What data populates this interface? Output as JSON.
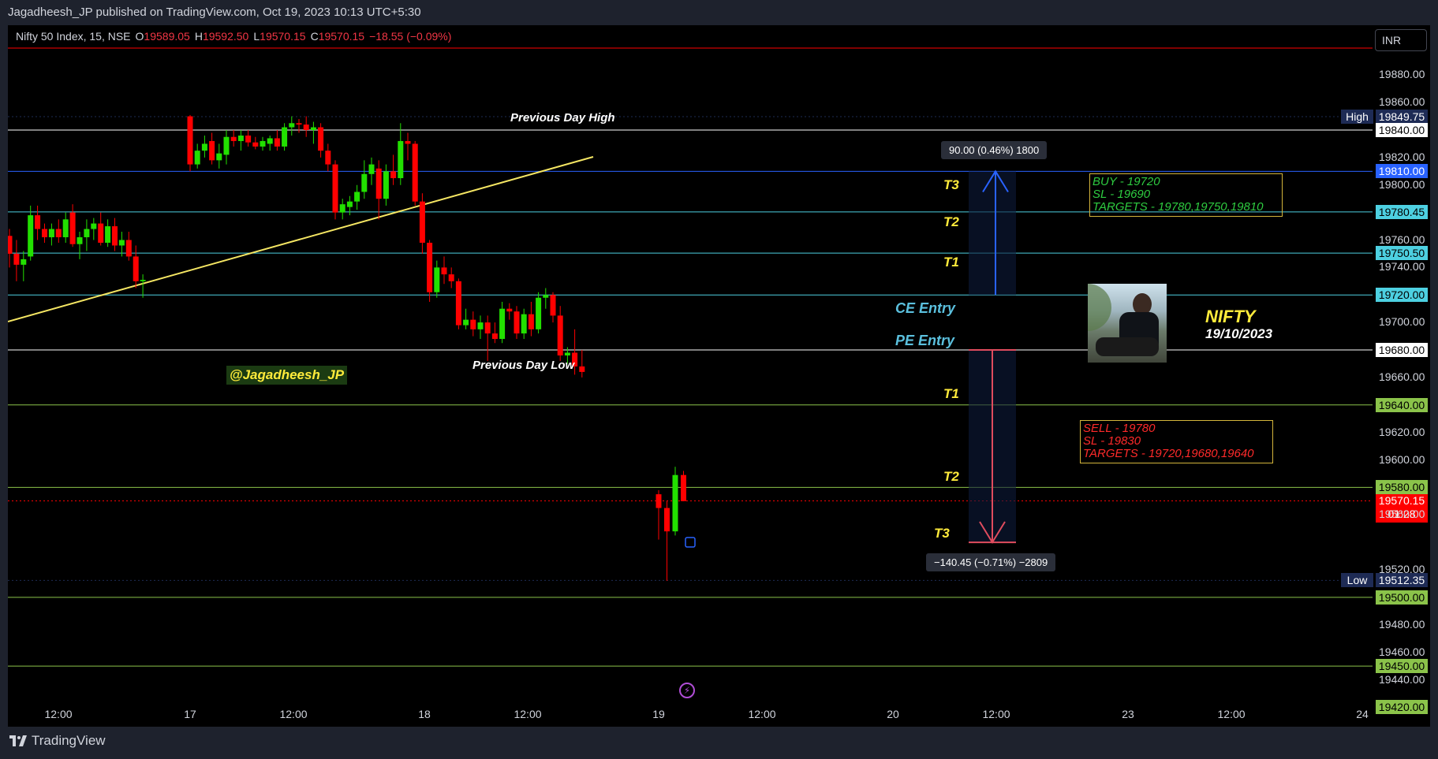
{
  "header": {
    "published_by": "Jagadheesh_JP published on TradingView.com, Oct 19, 2023 10:13 UTC+5:30"
  },
  "legend": {
    "symbol": "Nifty 50 Index, 15, NSE",
    "open_label": "O",
    "open": "19589.05",
    "high_label": "H",
    "high": "19592.50",
    "low_label": "L",
    "low": "19570.15",
    "close_label": "C",
    "close": "19570.15",
    "change": "−18.55 (−0.09%)"
  },
  "currency": "INR",
  "footer": {
    "logo_text": "TradingView"
  },
  "annotations": {
    "prev_day_high": "Previous Day High",
    "prev_day_low": "Previous Day Low",
    "handle": "@Jagadheesh_JP",
    "ce_entry": "CE Entry",
    "pe_entry": "PE Entry",
    "t3_up": "T3",
    "t2_up": "T2",
    "t1_up": "T1",
    "t1_down": "T1",
    "t2_down": "T2",
    "t3_down": "T3",
    "measure_up": "90.00 (0.46%) 1800",
    "measure_down": "−140.45 (−0.71%) −2809",
    "buy_lines": [
      "BUY - 19720",
      "SL - 19690",
      "TARGETS - 19780,19750,19810"
    ],
    "sell_lines": [
      "SELL - 19780",
      "SL - 19830",
      "TARGETS - 19720,19680,19640"
    ],
    "nifty_title": "NIFTY",
    "nifty_date": "19/10/2023"
  },
  "colors": {
    "up": "#22e000",
    "down": "#ff0000",
    "background": "#000000",
    "trendline": "#f5e663",
    "line_blue": "#2962ff",
    "line_cyan": "#4dd0e1",
    "line_green": "#8bc34a",
    "line_white": "#ffffff"
  },
  "price_labels": [
    {
      "value": "19849.75",
      "tag": "High",
      "bg": "#1e2b55",
      "fg": "#ffffff"
    },
    {
      "value": "19840.00",
      "bg": "#ffffff",
      "fg": "#000000"
    },
    {
      "value": "19810.00",
      "bg": "#2962ff",
      "fg": "#ffffff"
    },
    {
      "value": "19780.45",
      "bg": "#4dd0e1",
      "fg": "#000000"
    },
    {
      "value": "19750.50",
      "bg": "#4dd0e1",
      "fg": "#000000"
    },
    {
      "value": "19720.00",
      "bg": "#4dd0e1",
      "fg": "#000000"
    },
    {
      "value": "19680.00",
      "bg": "#ffffff",
      "fg": "#000000"
    },
    {
      "value": "19640.00",
      "bg": "#8bc34a",
      "fg": "#000000"
    },
    {
      "value": "19580.00",
      "bg": "#8bc34a",
      "fg": "#000000"
    },
    {
      "value": "19570.15",
      "sub": "01:28",
      "bg": "#ff0000",
      "fg": "#ffffff"
    },
    {
      "value": "19512.35",
      "tag": "Low",
      "bg": "#1e2b55",
      "fg": "#ffffff"
    },
    {
      "value": "19500.00",
      "bg": "#8bc34a",
      "fg": "#000000"
    },
    {
      "value": "19450.00",
      "bg": "#8bc34a",
      "fg": "#000000"
    },
    {
      "value": "19420.00",
      "bg": "#8bc34a",
      "fg": "#000000"
    }
  ],
  "chart_data": {
    "type": "candlestick",
    "symbol": "Nifty 50 Index",
    "interval": "15",
    "exchange": "NSE",
    "y_axis_ticks": [
      19880,
      19860,
      19820,
      19800,
      19760,
      19740,
      19700,
      19660,
      19620,
      19600,
      19560,
      19520,
      19480,
      19460,
      19440
    ],
    "x_axis_ticks": [
      "12:00",
      "17",
      "12:00",
      "18",
      "12:00",
      "19",
      "12:00",
      "20",
      "12:00",
      "23",
      "12:00",
      "24"
    ],
    "horizontal_levels": [
      {
        "price": 19849.75,
        "style": "dotted",
        "color": "#1e2b55"
      },
      {
        "price": 19840.0,
        "color": "#ffffff"
      },
      {
        "price": 19810.0,
        "color": "#2962ff"
      },
      {
        "price": 19780.45,
        "color": "#4dd0e1"
      },
      {
        "price": 19750.5,
        "color": "#4dd0e1"
      },
      {
        "price": 19720.0,
        "color": "#4dd0e1"
      },
      {
        "price": 19680.0,
        "color": "#ffffff"
      },
      {
        "price": 19640.0,
        "color": "#8bc34a"
      },
      {
        "price": 19580.0,
        "color": "#8bc34a"
      },
      {
        "price": 19570.15,
        "style": "dotted",
        "color": "#ff0000"
      },
      {
        "price": 19512.35,
        "style": "dotted",
        "color": "#1e2b55"
      },
      {
        "price": 19500.0,
        "color": "#8bc34a"
      },
      {
        "price": 19450.0,
        "color": "#8bc34a"
      }
    ],
    "candles": [
      {
        "o": 19763,
        "h": 19768,
        "l": 19740,
        "c": 19750
      },
      {
        "o": 19750,
        "h": 19760,
        "l": 19730,
        "c": 19742
      },
      {
        "o": 19742,
        "h": 19752,
        "l": 19730,
        "c": 19746
      },
      {
        "o": 19748,
        "h": 19785,
        "l": 19745,
        "c": 19778
      },
      {
        "o": 19778,
        "h": 19785,
        "l": 19760,
        "c": 19768
      },
      {
        "o": 19768,
        "h": 19772,
        "l": 19758,
        "c": 19762
      },
      {
        "o": 19762,
        "h": 19772,
        "l": 19756,
        "c": 19768
      },
      {
        "o": 19768,
        "h": 19775,
        "l": 19758,
        "c": 19762
      },
      {
        "o": 19762,
        "h": 19780,
        "l": 19758,
        "c": 19775
      },
      {
        "o": 19780,
        "h": 19786,
        "l": 19755,
        "c": 19757
      },
      {
        "o": 19757,
        "h": 19766,
        "l": 19746,
        "c": 19762
      },
      {
        "o": 19762,
        "h": 19775,
        "l": 19752,
        "c": 19768
      },
      {
        "o": 19768,
        "h": 19776,
        "l": 19760,
        "c": 19772
      },
      {
        "o": 19772,
        "h": 19780,
        "l": 19756,
        "c": 19758
      },
      {
        "o": 19758,
        "h": 19775,
        "l": 19755,
        "c": 19770
      },
      {
        "o": 19770,
        "h": 19776,
        "l": 19752,
        "c": 19756
      },
      {
        "o": 19756,
        "h": 19766,
        "l": 19748,
        "c": 19760
      },
      {
        "o": 19760,
        "h": 19766,
        "l": 19745,
        "c": 19748
      },
      {
        "o": 19748,
        "h": 19756,
        "l": 19725,
        "c": 19730
      },
      {
        "o": 19730,
        "h": 19735,
        "l": 19718,
        "c": 19731
      },
      {
        "o": 19850,
        "h": 19851,
        "l": 19810,
        "c": 19815
      },
      {
        "o": 19815,
        "h": 19830,
        "l": 19812,
        "c": 19825
      },
      {
        "o": 19825,
        "h": 19836,
        "l": 19820,
        "c": 19830
      },
      {
        "o": 19832,
        "h": 19838,
        "l": 19815,
        "c": 19818
      },
      {
        "o": 19818,
        "h": 19830,
        "l": 19812,
        "c": 19823
      },
      {
        "o": 19822,
        "h": 19840,
        "l": 19815,
        "c": 19835
      },
      {
        "o": 19835,
        "h": 19840,
        "l": 19828,
        "c": 19832
      },
      {
        "o": 19832,
        "h": 19840,
        "l": 19825,
        "c": 19836
      },
      {
        "o": 19836,
        "h": 19840,
        "l": 19828,
        "c": 19831
      },
      {
        "o": 19831,
        "h": 19835,
        "l": 19826,
        "c": 19828
      },
      {
        "o": 19828,
        "h": 19835,
        "l": 19825,
        "c": 19832
      },
      {
        "o": 19830,
        "h": 19836,
        "l": 19825,
        "c": 19834
      },
      {
        "o": 19834,
        "h": 19840,
        "l": 19825,
        "c": 19828
      },
      {
        "o": 19828,
        "h": 19845,
        "l": 19825,
        "c": 19842
      },
      {
        "o": 19842,
        "h": 19850,
        "l": 19836,
        "c": 19845
      },
      {
        "o": 19845,
        "h": 19848,
        "l": 19838,
        "c": 19844
      },
      {
        "o": 19844,
        "h": 19850,
        "l": 19835,
        "c": 19840
      },
      {
        "o": 19840,
        "h": 19846,
        "l": 19830,
        "c": 19842
      },
      {
        "o": 19842,
        "h": 19845,
        "l": 19820,
        "c": 19825
      },
      {
        "o": 19825,
        "h": 19830,
        "l": 19810,
        "c": 19815
      },
      {
        "o": 19815,
        "h": 19818,
        "l": 19775,
        "c": 19780
      },
      {
        "o": 19780,
        "h": 19790,
        "l": 19775,
        "c": 19786
      },
      {
        "o": 19784,
        "h": 19792,
        "l": 19778,
        "c": 19788
      },
      {
        "o": 19788,
        "h": 19800,
        "l": 19782,
        "c": 19795
      },
      {
        "o": 19795,
        "h": 19818,
        "l": 19790,
        "c": 19808
      },
      {
        "o": 19808,
        "h": 19820,
        "l": 19800,
        "c": 19815
      },
      {
        "o": 19812,
        "h": 19818,
        "l": 19775,
        "c": 19790
      },
      {
        "o": 19790,
        "h": 19815,
        "l": 19785,
        "c": 19810
      },
      {
        "o": 19810,
        "h": 19822,
        "l": 19800,
        "c": 19805
      },
      {
        "o": 19805,
        "h": 19845,
        "l": 19800,
        "c": 19832
      },
      {
        "o": 19832,
        "h": 19838,
        "l": 19818,
        "c": 19830
      },
      {
        "o": 19830,
        "h": 19832,
        "l": 19785,
        "c": 19788
      },
      {
        "o": 19788,
        "h": 19794,
        "l": 19750,
        "c": 19758
      },
      {
        "o": 19758,
        "h": 19760,
        "l": 19715,
        "c": 19722
      },
      {
        "o": 19722,
        "h": 19745,
        "l": 19718,
        "c": 19740
      },
      {
        "o": 19740,
        "h": 19748,
        "l": 19728,
        "c": 19735
      },
      {
        "o": 19735,
        "h": 19740,
        "l": 19725,
        "c": 19730
      },
      {
        "o": 19730,
        "h": 19732,
        "l": 19695,
        "c": 19698
      },
      {
        "o": 19698,
        "h": 19710,
        "l": 19695,
        "c": 19702
      },
      {
        "o": 19702,
        "h": 19708,
        "l": 19690,
        "c": 19695
      },
      {
        "o": 19695,
        "h": 19705,
        "l": 19688,
        "c": 19700
      },
      {
        "o": 19700,
        "h": 19705,
        "l": 19672,
        "c": 19692
      },
      {
        "o": 19692,
        "h": 19700,
        "l": 19685,
        "c": 19688
      },
      {
        "o": 19688,
        "h": 19715,
        "l": 19685,
        "c": 19710
      },
      {
        "o": 19710,
        "h": 19714,
        "l": 19702,
        "c": 19708
      },
      {
        "o": 19708,
        "h": 19712,
        "l": 19688,
        "c": 19692
      },
      {
        "o": 19692,
        "h": 19710,
        "l": 19688,
        "c": 19706
      },
      {
        "o": 19706,
        "h": 19715,
        "l": 19690,
        "c": 19695
      },
      {
        "o": 19695,
        "h": 19722,
        "l": 19692,
        "c": 19718
      },
      {
        "o": 19718,
        "h": 19725,
        "l": 19710,
        "c": 19720
      },
      {
        "o": 19720,
        "h": 19722,
        "l": 19700,
        "c": 19705
      },
      {
        "o": 19705,
        "h": 19712,
        "l": 19672,
        "c": 19676
      },
      {
        "o": 19676,
        "h": 19682,
        "l": 19670,
        "c": 19678
      },
      {
        "o": 19678,
        "h": 19695,
        "l": 19662,
        "c": 19668
      },
      {
        "o": 19668,
        "h": 19680,
        "l": 19660,
        "c": 19664
      },
      {
        "o": 19575,
        "h": 19578,
        "l": 19542,
        "c": 19565
      },
      {
        "o": 19565,
        "h": 19570,
        "l": 19512,
        "c": 19548
      },
      {
        "o": 19548,
        "h": 19595,
        "l": 19545,
        "c": 19589
      },
      {
        "o": 19589,
        "h": 19592,
        "l": 19570,
        "c": 19570
      }
    ]
  }
}
